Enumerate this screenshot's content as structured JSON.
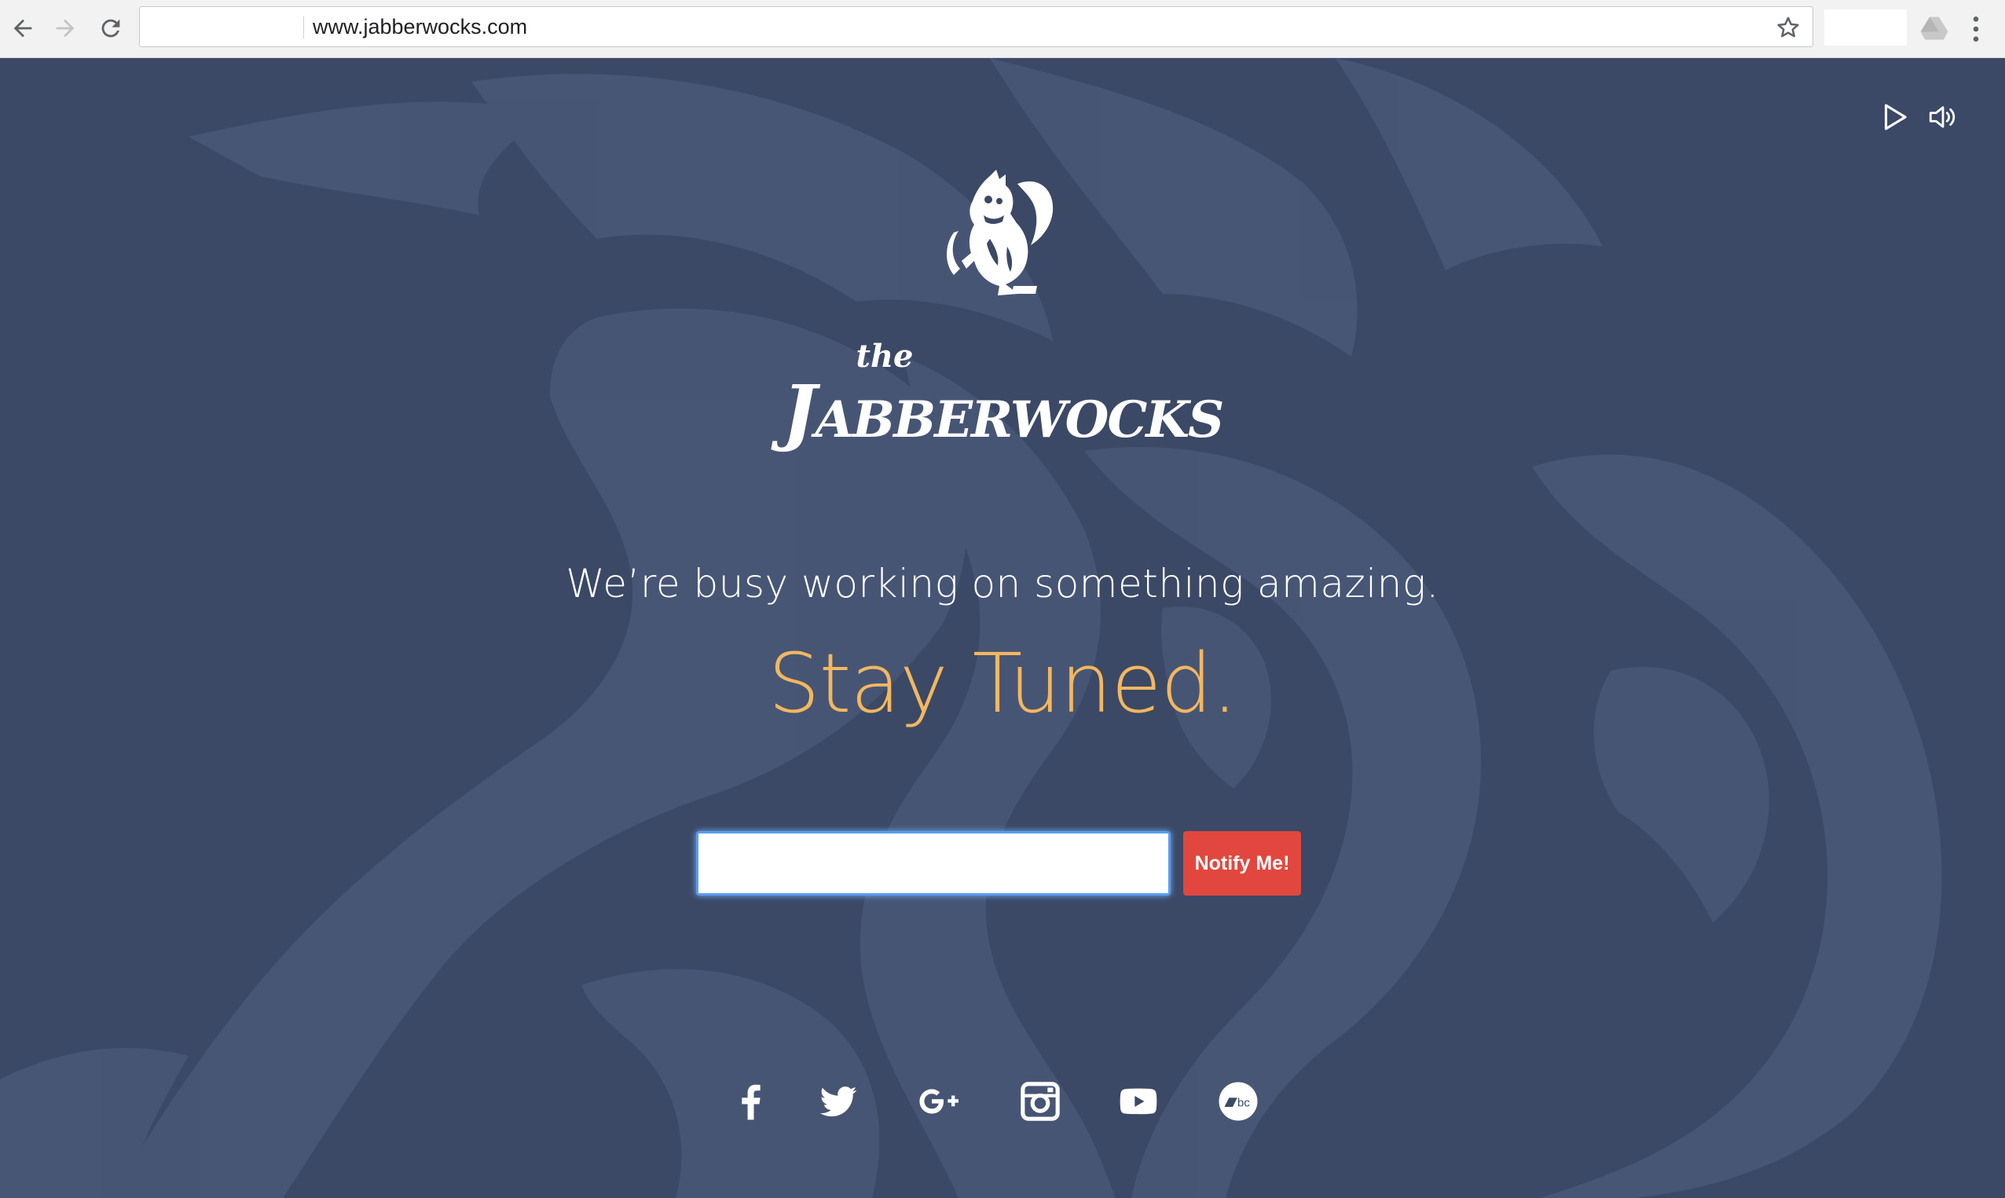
{
  "browser": {
    "url": "www.jabberwocks.com",
    "icons": [
      "back-arrow-icon",
      "forward-arrow-icon",
      "reload-icon",
      "bookmark-star-icon",
      "google-drive-icon",
      "menu-dots-icon"
    ]
  },
  "page": {
    "logo": {
      "small_word": "the",
      "name": "Jabberwocks"
    },
    "tagline": "We’re busy working on something amazing.",
    "headline": "Stay Tuned.",
    "email_input": {
      "value": "",
      "placeholder": ""
    },
    "notify_button_label": "Notify Me!",
    "media_controls": [
      "play-icon",
      "volume-icon"
    ],
    "social_icons": [
      "facebook-icon",
      "twitter-icon",
      "google-plus-icon",
      "instagram-icon",
      "youtube-icon",
      "bandcamp-icon"
    ],
    "colors": {
      "background": "#3b4966",
      "headline": "#f3b75f",
      "button": "#e1473e",
      "text": "#ffffff"
    }
  }
}
